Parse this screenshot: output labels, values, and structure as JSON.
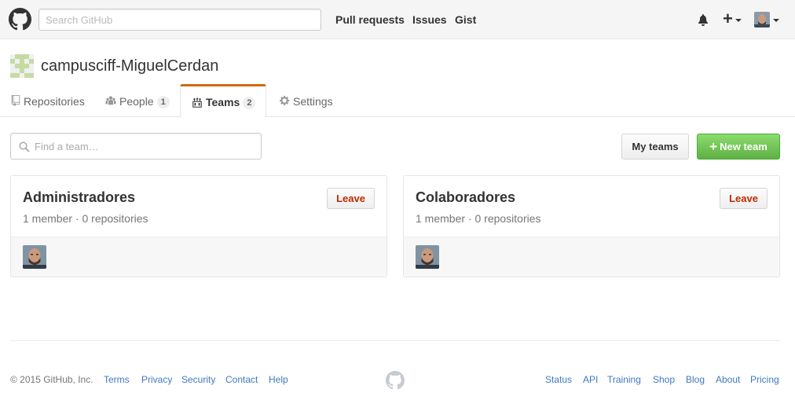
{
  "header": {
    "search_placeholder": "Search GitHub",
    "nav": [
      "Pull requests",
      "Issues",
      "Gist"
    ],
    "new_icon": "plus-icon",
    "notifications_icon": "bell-icon"
  },
  "org": {
    "name": "campusciff-MiguelCerdan"
  },
  "tabs": [
    {
      "label": "Repositories",
      "icon": "repo-icon"
    },
    {
      "label": "People",
      "count": "1",
      "icon": "people-icon"
    },
    {
      "label": "Teams",
      "count": "2",
      "icon": "team-icon",
      "selected": true
    },
    {
      "label": "Settings",
      "icon": "gear-icon"
    }
  ],
  "toolbar": {
    "find_placeholder": "Find a team…",
    "my_teams_label": "My teams",
    "new_team_label": "New team"
  },
  "teams": [
    {
      "name": "Administradores",
      "members": "1 member",
      "repos": "0 repositories",
      "leave_label": "Leave"
    },
    {
      "name": "Colaboradores",
      "members": "1 member",
      "repos": "0 repositories",
      "leave_label": "Leave"
    }
  ],
  "footer": {
    "copyright": "© 2015 GitHub, Inc.",
    "left_links": [
      "Terms",
      "Privacy",
      "Security",
      "Contact",
      "Help"
    ],
    "right_links": [
      "Status",
      "API",
      "Training",
      "Shop",
      "Blog",
      "About",
      "Pricing"
    ]
  },
  "colors": {
    "accent_tab": "#d26911",
    "new_team_green": "#6cc644",
    "leave_red": "#bd2c00",
    "link_blue": "#4078c0"
  }
}
